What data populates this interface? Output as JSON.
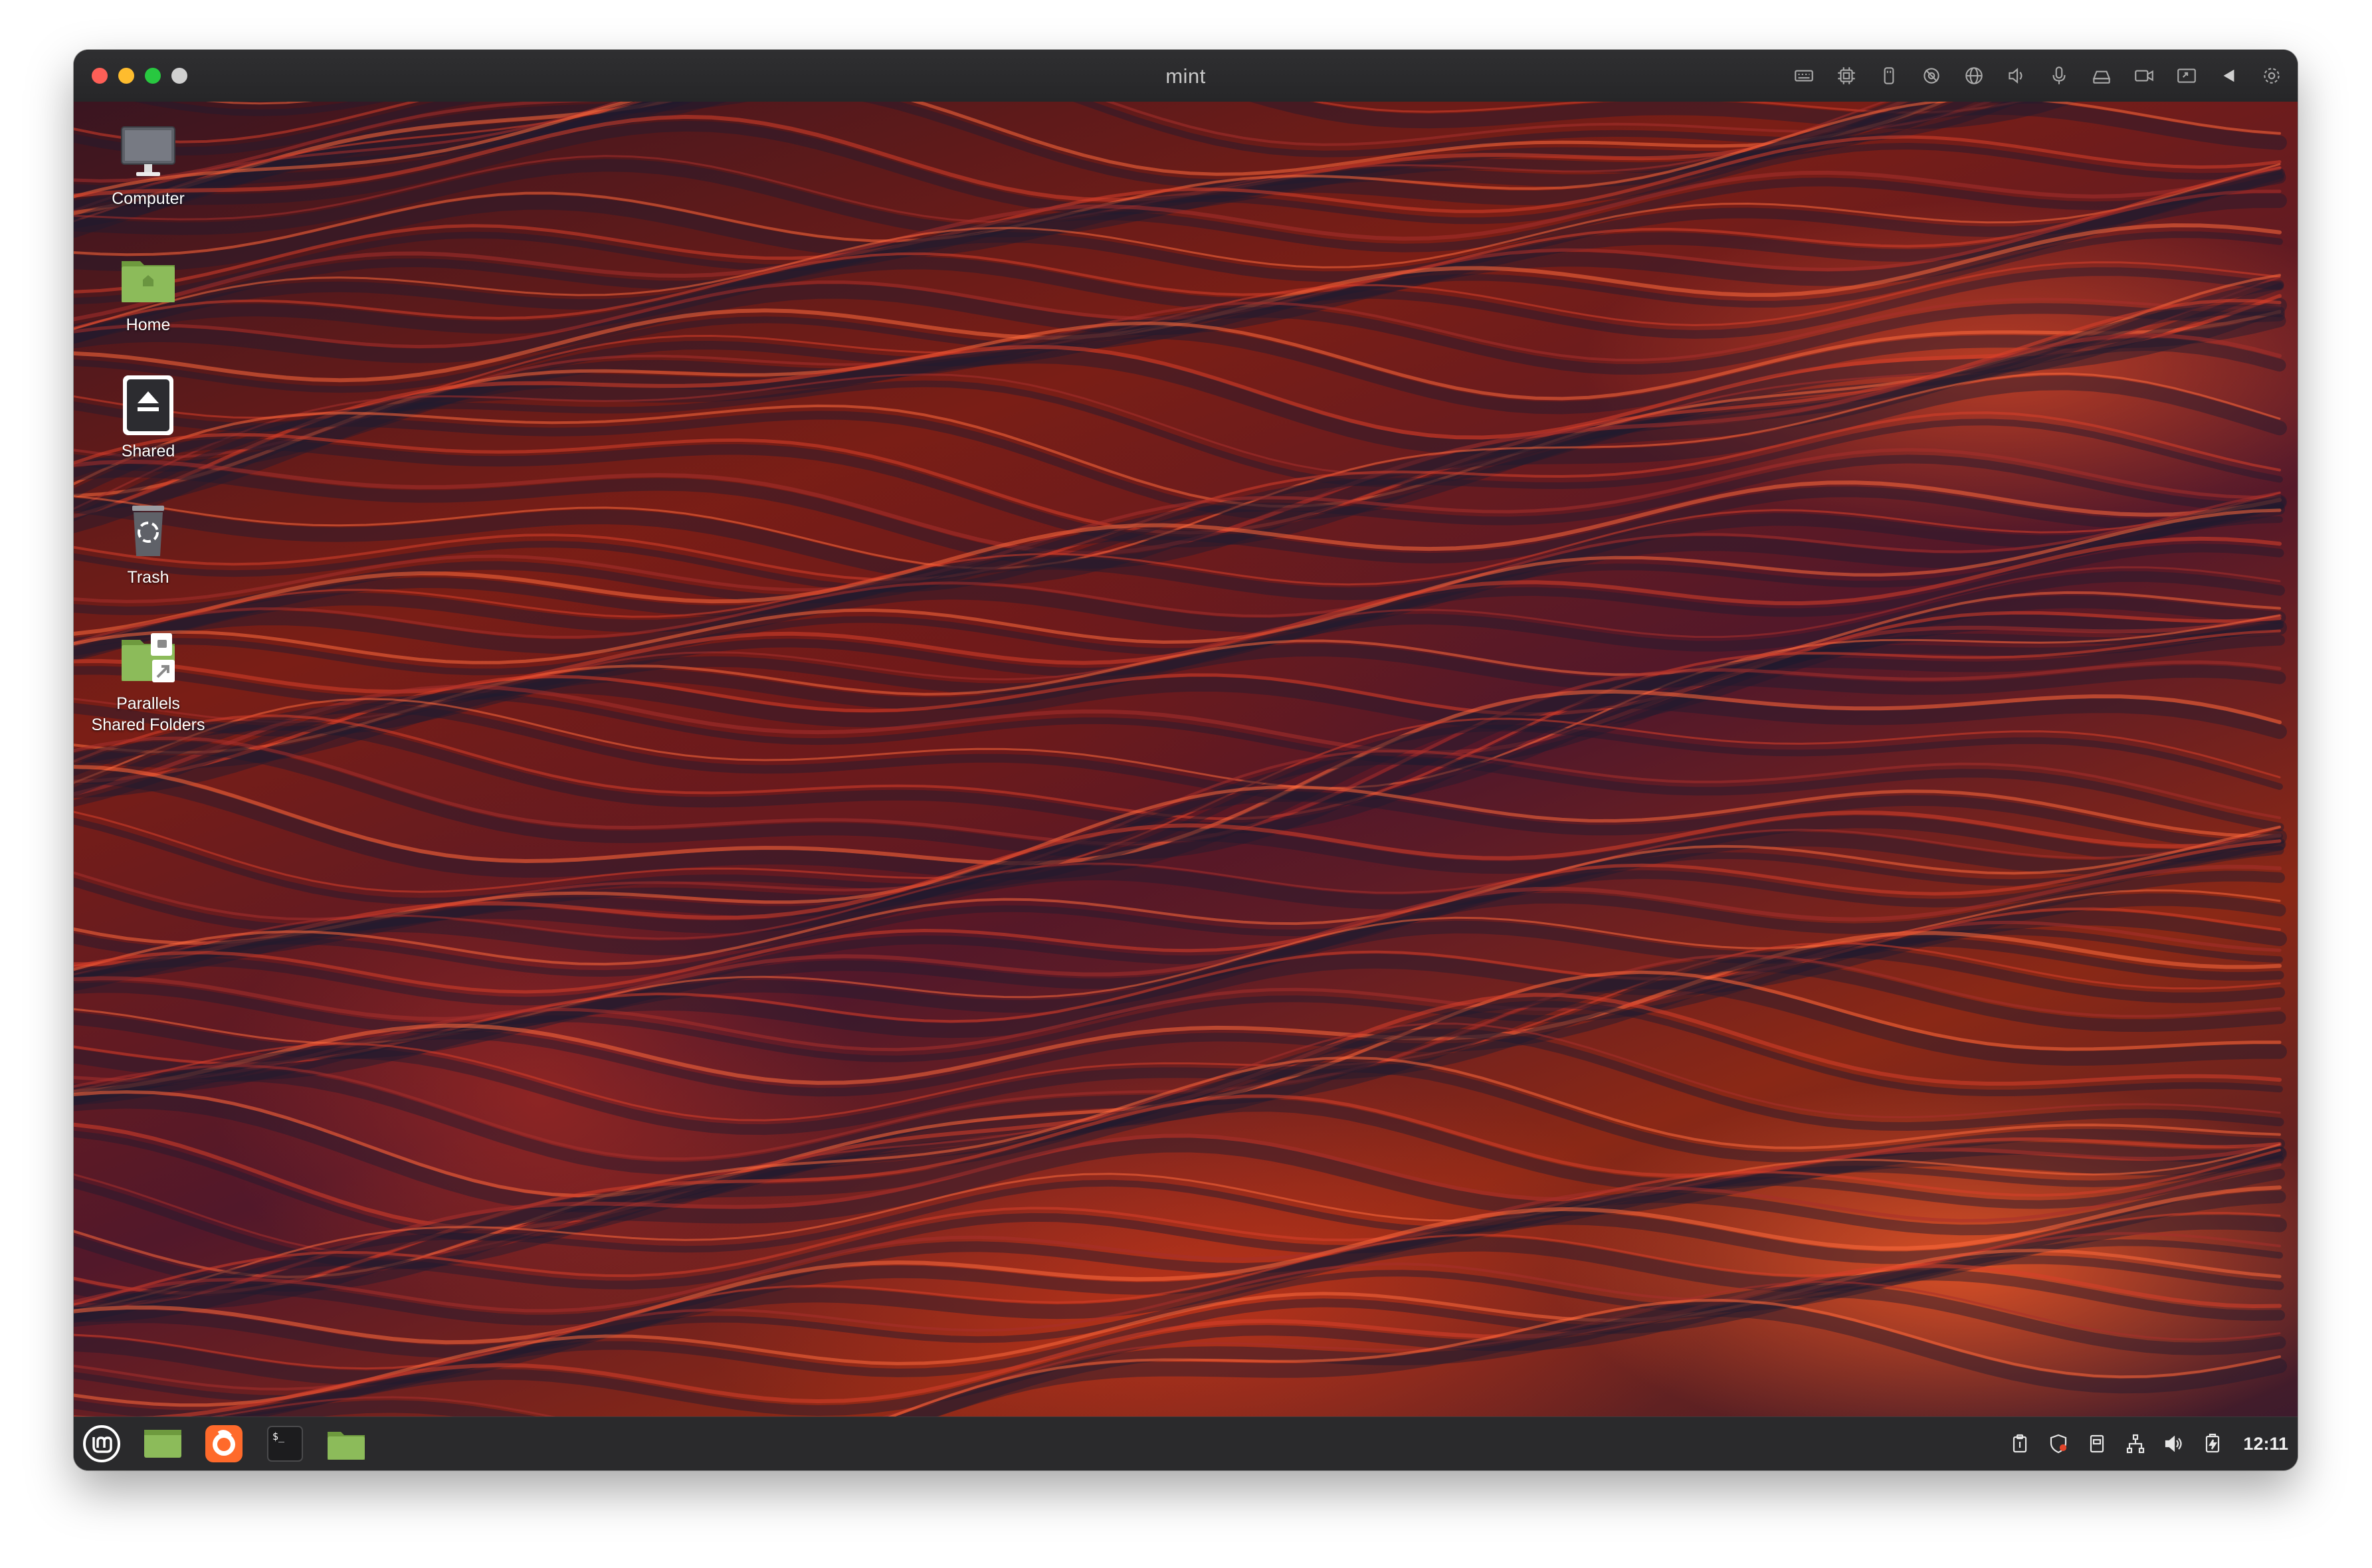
{
  "window": {
    "title": "mint"
  },
  "titlebar_icons": [
    "keyboard-icon",
    "cpu-icon",
    "usb-icon",
    "camera-off-icon",
    "globe-icon",
    "speaker-icon",
    "microphone-icon",
    "drive-icon",
    "video-camera-icon",
    "screen-share-icon",
    "arrow-left-icon",
    "gear-icon"
  ],
  "desktop": {
    "icons": [
      {
        "label": "Computer",
        "icon": "computer-icon"
      },
      {
        "label": "Home",
        "icon": "home-folder-icon"
      },
      {
        "label": "Shared",
        "icon": "shared-drive-icon"
      },
      {
        "label": "Trash",
        "icon": "trash-icon"
      },
      {
        "label": "Parallels Shared Folders",
        "icon": "shared-folder-icon"
      }
    ]
  },
  "taskbar": {
    "apps": [
      "menu-icon",
      "show-desktop-icon",
      "firefox-icon",
      "terminal-icon",
      "files-icon"
    ],
    "tray": [
      "clipboard-icon",
      "shield-icon",
      "notes-icon",
      "network-icon",
      "volume-icon",
      "battery-icon"
    ],
    "clock": "12:11"
  },
  "colors": {
    "accent_red": "#e2452a",
    "taskbar_bg": "#2a2a2c",
    "mint_green": "#8cbb5a"
  }
}
